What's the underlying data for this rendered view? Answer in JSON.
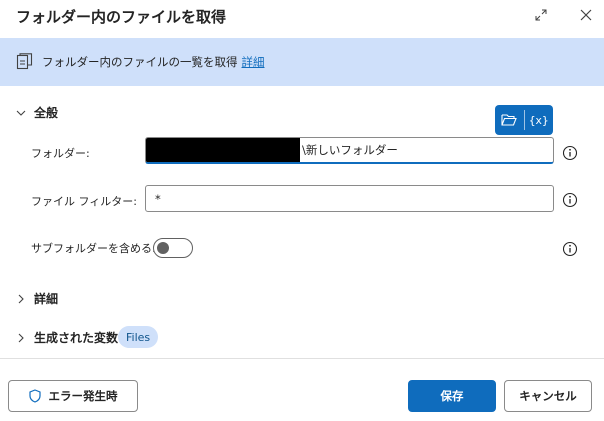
{
  "dialog": {
    "title": "フォルダー内のファイルを取得"
  },
  "banner": {
    "description": "フォルダー内のファイルの一覧を取得",
    "details_link": "詳細"
  },
  "sections": {
    "general": "全般",
    "details": "詳細",
    "generated_variables": "生成された変数"
  },
  "fields": {
    "folder": {
      "label": "フォルダー:",
      "value": "\\新しいフォルダー"
    },
    "file_filter": {
      "label": "ファイル フィルター:",
      "value": "*"
    },
    "include_subfolders": {
      "label": "サブフォルダーを含める:",
      "checked": false
    }
  },
  "variable_picker": {
    "label": "{x}"
  },
  "generated_variable_badge": "Files",
  "footer": {
    "on_error_label": "エラー発生時",
    "save_label": "保存",
    "cancel_label": "キャンセル"
  },
  "colors": {
    "accent": "#0f6cbd",
    "banner_bg": "#cfe0fa"
  }
}
